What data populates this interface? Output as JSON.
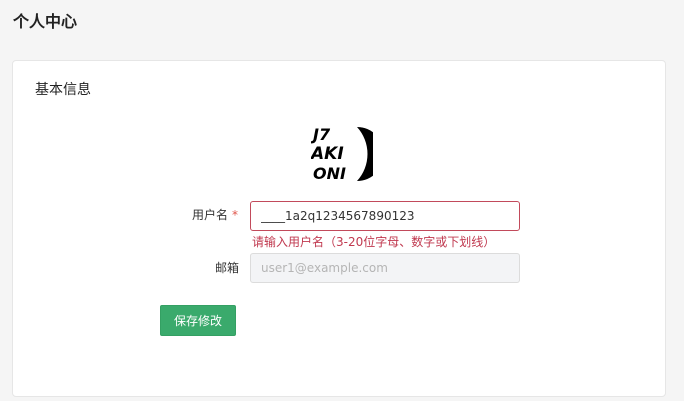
{
  "page": {
    "title": "个人中心"
  },
  "card": {
    "title": "基本信息"
  },
  "avatar": {
    "lines": [
      "J7",
      "AKI",
      "ONI"
    ],
    "icon": "avatar-logo"
  },
  "form": {
    "username": {
      "label": "用户名",
      "required_mark": "*",
      "value": "____1a2q1234567890123",
      "error": "请输入用户名（3-20位字母、数字或下划线）"
    },
    "email": {
      "label": "邮箱",
      "value": "",
      "placeholder": "user1@example.com"
    },
    "save_label": "保存修改"
  },
  "colors": {
    "primary_button": "#3aaa6c",
    "error": "#c0394f",
    "required": "#e0564c"
  }
}
